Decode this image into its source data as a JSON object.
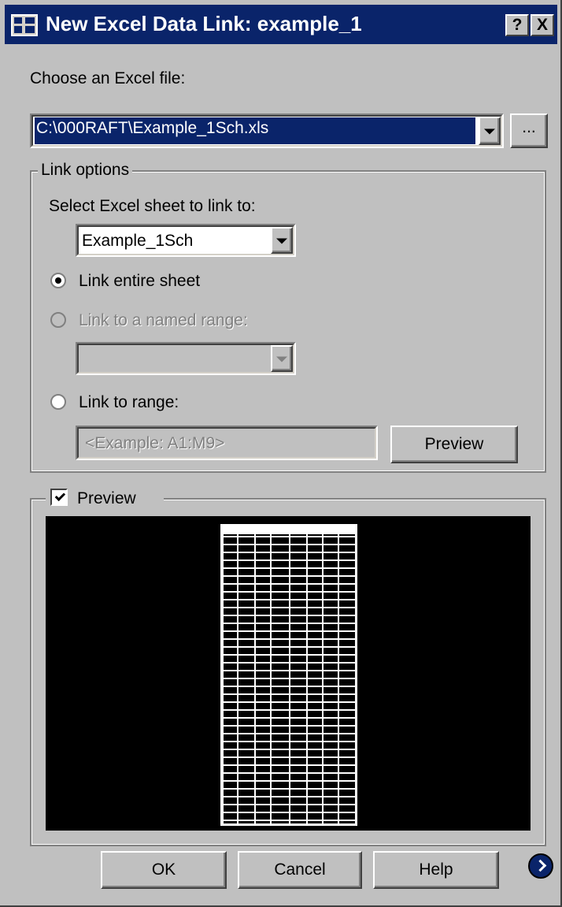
{
  "window": {
    "title": "New Excel Data Link: example_1",
    "help_button": "?",
    "close_button": "X",
    "colors": {
      "titlebar": "#0a246a",
      "face": "#c0c0c0",
      "preview_background": "#000000"
    }
  },
  "file": {
    "label": "Choose an Excel file:",
    "value": "C:\\000RAFT\\Example_1Sch.xls",
    "browse_label": "..."
  },
  "link_options": {
    "legend": "Link options",
    "sheet_label": "Select Excel sheet to link to:",
    "sheet_value": "Example_1Sch",
    "radio_entire": "Link entire sheet",
    "radio_named": "Link to a named range:",
    "named_range_value": "",
    "radio_range": "Link to range:",
    "range_placeholder": "<Example: A1:M9>",
    "range_preview_button": "Preview",
    "selected": "entire"
  },
  "preview": {
    "legend": "Preview",
    "checked": true
  },
  "buttons": {
    "ok": "OK",
    "cancel": "Cancel",
    "help": "Help"
  },
  "icons": {
    "app": "excel-data-link-icon",
    "expand": "chevron-right-circle-icon"
  }
}
